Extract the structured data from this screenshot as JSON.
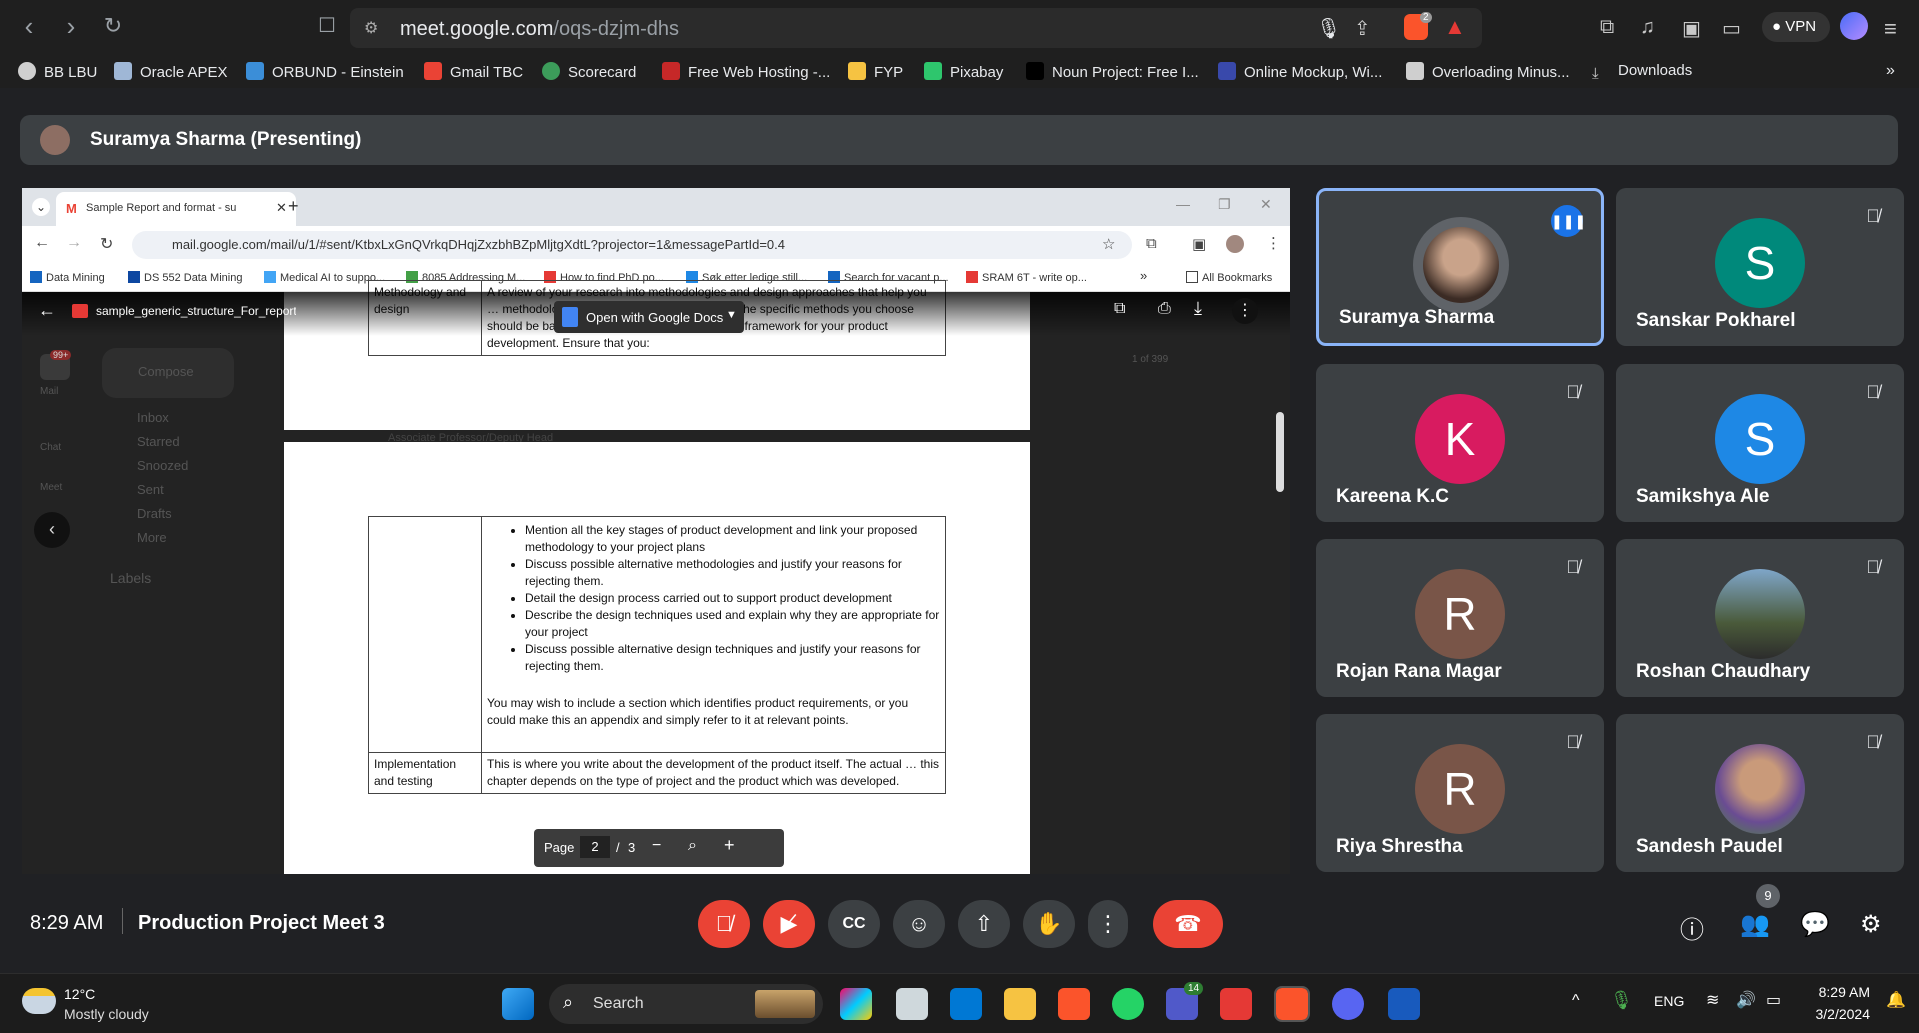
{
  "browser": {
    "url_host": "meet.google.com",
    "url_path": "/oqs-dzjm-dhs",
    "vpn_label": "VPN",
    "shield_badge": "2",
    "bookmarks": [
      {
        "label": "BB LBU",
        "color": "#cfcfcf"
      },
      {
        "label": "Oracle APEX",
        "color": "#9fb7d6"
      },
      {
        "label": "ORBUND - Einstein",
        "color": "#3b8ed8"
      },
      {
        "label": "Gmail TBC",
        "color": "#ea4335"
      },
      {
        "label": "Scorecard",
        "color": "#3c9c5a"
      },
      {
        "label": "Free Web Hosting -...",
        "color": "#c62828"
      },
      {
        "label": "FYP",
        "color": "#f6c342"
      },
      {
        "label": "Pixabay",
        "color": "#2ec66d"
      },
      {
        "label": "Noun Project: Free I...",
        "color": "#000000"
      },
      {
        "label": "Online Mockup, Wi...",
        "color": "#3949ab"
      },
      {
        "label": "Overloading Minus...",
        "color": "#cfcfcf"
      },
      {
        "label": "Downloads",
        "color": "#cfcfcf"
      }
    ]
  },
  "meet": {
    "presenter_label": "Suramya Sharma (Presenting)",
    "time": "8:29 AM",
    "meeting_title": "Production Project Meet 3",
    "people_count": "9",
    "participants": [
      {
        "name": "Suramya Sharma",
        "initial": "",
        "color": "#7a5a4a",
        "speaking": true
      },
      {
        "name": "Sanskar Pokharel",
        "initial": "S",
        "color": "#00897b",
        "speaking": false
      },
      {
        "name": "Kareena K.C",
        "initial": "K",
        "color": "#d81b60",
        "speaking": false
      },
      {
        "name": "Samikshya Ale",
        "initial": "S",
        "color": "#1e88e5",
        "speaking": false
      },
      {
        "name": "Rojan Rana Magar",
        "initial": "R",
        "color": "#795548",
        "speaking": false
      },
      {
        "name": "Roshan Chaudhary",
        "initial": "",
        "color": "#5d6b4f",
        "speaking": false
      },
      {
        "name": "Riya Shrestha",
        "initial": "R",
        "color": "#795548",
        "speaking": false
      },
      {
        "name": "Sandesh Paudel",
        "initial": "",
        "color": "#6a4c93",
        "speaking": false
      }
    ]
  },
  "shared": {
    "tab_title": "Sample Report and format - su",
    "url": "mail.google.com/mail/u/1/#sent/KtbxLxGnQVrkqDHqjZxzbhBZpMljtgXdtL?projector=1&messagePartId=0.4",
    "bookmarks": [
      {
        "label": "Data Mining",
        "color": "#1565c0"
      },
      {
        "label": "DS 552 Data Mining",
        "color": "#0d47a1"
      },
      {
        "label": "Medical AI to suppo...",
        "color": "#42a5f5"
      },
      {
        "label": "8085 Addressing M...",
        "color": "#43a047"
      },
      {
        "label": "How to find PhD po...",
        "color": "#e53935"
      },
      {
        "label": "Søk etter ledige still...",
        "color": "#1e88e5"
      },
      {
        "label": "Search for vacant p...",
        "color": "#1565c0"
      },
      {
        "label": "SRAM 6T - write op...",
        "color": "#e53935"
      }
    ],
    "all_bookmarks": "All Bookmarks",
    "pdf_filename": "sample_generic_structure_For_report.pdf",
    "open_with": "Open with Google Docs",
    "gmail_items": [
      "Compose",
      "Inbox",
      "Starred",
      "Snoozed",
      "Sent",
      "Drafts",
      "More",
      "Labels",
      "Mail",
      "Chat",
      "Meet"
    ],
    "gmail_badge": "99+",
    "gmail_pager": "1 of 399",
    "faded_text": "Associate Professor/Deputy Head",
    "row1_label": "Methodology and design",
    "row1_text": "A review of your research into methodologies and design approaches that help you … methodologies can be formal or informal but the specific methods you choose should be based on research and should form a framework for your product development.  Ensure that you:",
    "bullets": [
      "Mention all the key stages of product development and link your proposed methodology to your project plans",
      "Discuss possible alternative methodologies and justify your reasons for rejecting them.",
      "Detail the design process carried out to support product development",
      "Describe the design techniques used and explain why they are appropriate for your project",
      "Discuss possible alternative design techniques and justify your reasons for rejecting them."
    ],
    "appendix_note": "You may wish to include a section which identifies product requirements, or you could make this an appendix and simply refer to it at relevant points.",
    "row3_label": "Implementation and testing",
    "row3_text": "This is where you write about the development of the product itself. The actual … this chapter depends on the type of project and the product which was developed.",
    "page_label": "Page",
    "page_current": "2",
    "page_sep": "/",
    "page_total": "3"
  },
  "taskbar": {
    "temp": "12°C",
    "weather": "Mostly cloudy",
    "search": "Search",
    "lang": "ENG",
    "time": "8:29 AM",
    "date": "3/2/2024",
    "teams_badge": "14"
  }
}
